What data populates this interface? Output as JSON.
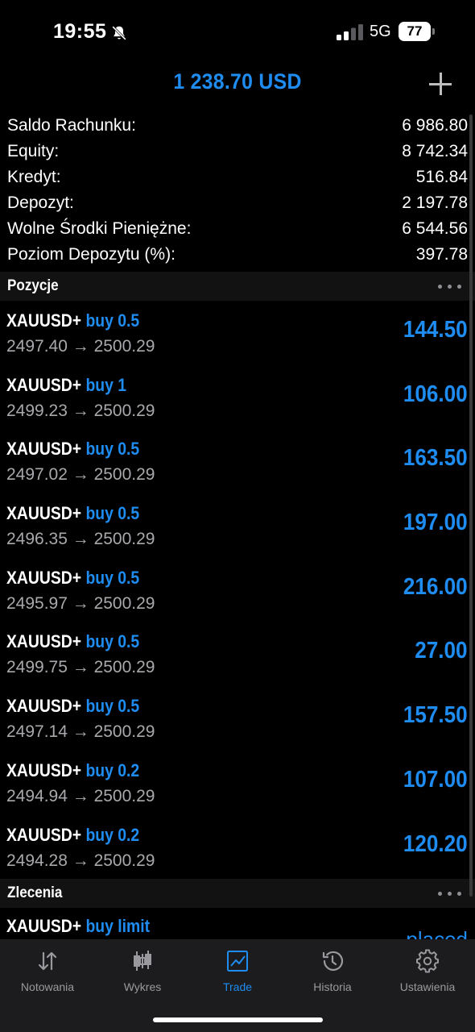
{
  "status_bar": {
    "time": "19:55",
    "network": "5G",
    "battery": "77"
  },
  "header": {
    "balance": "1 238.70 USD"
  },
  "summary": [
    {
      "label": "Saldo Rachunku:",
      "value": "6 986.80"
    },
    {
      "label": "Equity:",
      "value": "8 742.34"
    },
    {
      "label": "Kredyt:",
      "value": "516.84"
    },
    {
      "label": "Depozyt:",
      "value": "2 197.78"
    },
    {
      "label": "Wolne Środki Pieniężne:",
      "value": "6 544.56"
    },
    {
      "label": "Poziom Depozytu (%):",
      "value": "397.78"
    }
  ],
  "sections": {
    "positions": "Pozycje",
    "orders": "Zlecenia"
  },
  "positions": [
    {
      "symbol": "XAUUSD+",
      "side": "buy 0.5",
      "prices": "2497.40 → 2500.29",
      "profit": "144.50"
    },
    {
      "symbol": "XAUUSD+",
      "side": "buy 1",
      "prices": "2499.23 → 2500.29",
      "profit": "106.00"
    },
    {
      "symbol": "XAUUSD+",
      "side": "buy 0.5",
      "prices": "2497.02 → 2500.29",
      "profit": "163.50"
    },
    {
      "symbol": "XAUUSD+",
      "side": "buy 0.5",
      "prices": "2496.35 → 2500.29",
      "profit": "197.00"
    },
    {
      "symbol": "XAUUSD+",
      "side": "buy 0.5",
      "prices": "2495.97 → 2500.29",
      "profit": "216.00"
    },
    {
      "symbol": "XAUUSD+",
      "side": "buy 0.5",
      "prices": "2499.75 → 2500.29",
      "profit": "27.00"
    },
    {
      "symbol": "XAUUSD+",
      "side": "buy 0.5",
      "prices": "2497.14 → 2500.29",
      "profit": "157.50"
    },
    {
      "symbol": "XAUUSD+",
      "side": "buy 0.2",
      "prices": "2494.94 → 2500.29",
      "profit": "107.00"
    },
    {
      "symbol": "XAUUSD+",
      "side": "buy 0.2",
      "prices": "2494.28 → 2500.29",
      "profit": "120.20"
    }
  ],
  "orders": [
    {
      "symbol": "XAUUSD+",
      "side": "buy limit",
      "status": "placed"
    }
  ],
  "tabs": [
    {
      "label": "Notowania",
      "icon": "quotes-arrows-icon",
      "active": false
    },
    {
      "label": "Wykres",
      "icon": "candlestick-chart-icon",
      "active": false
    },
    {
      "label": "Trade",
      "icon": "trade-chart-icon",
      "active": true
    },
    {
      "label": "Historia",
      "icon": "history-clock-icon",
      "active": false
    },
    {
      "label": "Ustawienia",
      "icon": "gear-icon",
      "active": false
    }
  ],
  "colors": {
    "accent": "#1e8cf0",
    "background": "#000000",
    "muted": "#a9a9ad",
    "tabbar": "#1c1c1e"
  }
}
